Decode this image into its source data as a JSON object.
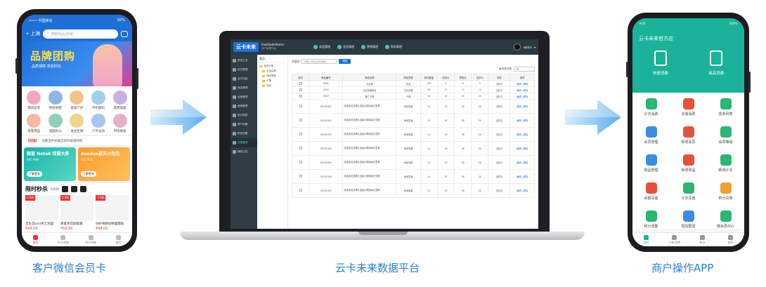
{
  "captions": {
    "customer": "客户微信会员卡",
    "platform": "云卡未来数据平台",
    "merchant": "商户操作APP"
  },
  "customer_phone": {
    "status_left": "•••• 中国移动",
    "status_right": "50%",
    "location": "上海",
    "search_placeholder": "搜索商品/店铺",
    "banner_title": "品牌团购",
    "banner_sub": "品质保障  享受折扣",
    "categories": [
      "潮流女装",
      "男装男鞋",
      "美妆个护",
      "手机数码",
      "家用电器",
      "母婴用品",
      "电脑办公",
      "食品生鲜",
      "户外运动",
      "时尚家居"
    ],
    "notice_tag": "【热销】",
    "notice_text": "大鹏当手机端全新升级限时抢",
    "promos": [
      {
        "title": "魅蓝 Note6 双摄大屏",
        "sub": "SSC Mall",
        "btn": "了解更多"
      },
      {
        "title": "doodoo夏天小包包",
        "sub": "SSC Mall",
        "btn": "了解更多"
      }
    ],
    "flash_title": "限时秒杀",
    "flash_sub": "8点场",
    "goods": [
      {
        "badge": "1 6折",
        "name": "吉生堂uno男士洗面",
        "price": "¥49.00"
      },
      {
        "badge": "1 6折",
        "name": "果麦茶花颜紫霜",
        "price": "¥50.00"
      },
      {
        "badge": "1 6折",
        "name": "SNP海豚动物面膜贴",
        "price": "¥98.00"
      }
    ],
    "tabs": [
      "首页",
      "积分商城",
      "积分明细",
      "我的"
    ]
  },
  "platform": {
    "logo": "云卡未来",
    "brand_name": "FastSaleHome",
    "brand_sub": "商户管理平台",
    "nav": [
      "商品管理",
      "会员管理",
      "营销管理",
      "财务管理"
    ],
    "user": "admin",
    "sidebar": [
      "系统主页",
      "会员管理",
      "会员功能",
      "商品管理",
      "运营管理",
      "营销管理",
      "统计报表",
      "商户设置",
      "系统设置",
      "权限管理",
      "通知公告"
    ],
    "sidebar_active_index": 9,
    "tree_header": "商品",
    "tree_nodes": [
      "全部分类",
      "五谷杂粮",
      "休闲零食",
      "干果",
      "饮品"
    ],
    "filter_label": "关键词",
    "filter_placeholder": "请输入商品名称/编码",
    "filter_button": "搜索",
    "pager_label": "每页显示数",
    "pager_value": "10",
    "columns": [
      "选中",
      "商品编号",
      "商品名称",
      "商品类别",
      "库存数量",
      "成本价",
      "零售价",
      "会员价",
      "状态",
      "操作"
    ],
    "rows": [
      [
        "",
        "0001",
        "乌龙茶",
        "饮品",
        "100",
        "3",
        "6",
        "5",
        "出售中",
        "编辑 | 删除"
      ],
      [
        "",
        "0002",
        "五谷杂粮组合",
        "五谷杂粮",
        "50",
        "8",
        "15",
        "12",
        "出售中",
        "编辑 | 删除"
      ],
      [
        "",
        "0003",
        "果仁干果",
        "干果",
        "20",
        "12",
        "25",
        "20",
        "出售中",
        "编辑 | 删除"
      ],
      [
        "",
        "SP201901",
        "精选混合坚果礼盒装大颗粒每日坚果",
        "休闲零食",
        "10",
        "30",
        "58",
        "50",
        "出售中",
        "编辑 | 删除"
      ],
      [
        "",
        "SP201902",
        "精选混合坚果礼盒装大颗粒每日坚果",
        "休闲零食",
        "10",
        "30",
        "58",
        "50",
        "出售中",
        "编辑 | 删除"
      ],
      [
        "",
        "SP201903",
        "精选混合坚果礼盒装大颗粒每日坚果",
        "休闲零食",
        "10",
        "30",
        "58",
        "50",
        "出售中",
        "编辑 | 删除"
      ],
      [
        "",
        "SP201904",
        "精选混合坚果礼盒装大颗粒每日坚果",
        "休闲零食",
        "10",
        "30",
        "58",
        "50",
        "出售中",
        "编辑 | 删除"
      ],
      [
        "",
        "SP201905",
        "精选混合坚果礼盒装大颗粒每日坚果",
        "休闲零食",
        "10",
        "30",
        "58",
        "50",
        "出售中",
        "编辑 | 删除"
      ],
      [
        "",
        "SP201906",
        "精选混合坚果礼盒装大颗粒每日坚果",
        "休闲零食",
        "10",
        "30",
        "58",
        "50",
        "出售中",
        "编辑 | 删除"
      ],
      [
        "",
        "SP201907",
        "精选混合坚果礼盒装大颗粒每日坚果",
        "休闲零食",
        "10",
        "30",
        "58",
        "50",
        "出售中",
        "编辑 | 删除"
      ]
    ]
  },
  "merchant_phone": {
    "status_left": "9:41",
    "status_right": "100%",
    "shop_name": "云卡未来官方店",
    "quick": [
      "快速消费",
      "商品消费"
    ],
    "menu": [
      {
        "label": "计次消费",
        "color": "#2bb673"
      },
      {
        "label": "充值消费",
        "color": "#e8503a"
      },
      {
        "label": "挂单列表",
        "color": "#2bb673"
      },
      {
        "label": "会员管理",
        "color": "#3a8ee6"
      },
      {
        "label": "新增会员",
        "color": "#e8503a"
      },
      {
        "label": "会员等级",
        "color": "#2bb673"
      },
      {
        "label": "商品管理",
        "color": "#3a8ee6"
      },
      {
        "label": "新增商品",
        "color": "#e8503a"
      },
      {
        "label": "新增计次",
        "color": "#2bb673"
      },
      {
        "label": "余额充值",
        "color": "#e8503a"
      },
      {
        "label": "计次充值",
        "color": "#2bb673"
      },
      {
        "label": "积分兑换",
        "color": "#f0a030"
      },
      {
        "label": "积分调整",
        "color": "#2bb673"
      },
      {
        "label": "短信群发",
        "color": "#3a8ee6"
      },
      {
        "label": "微会员中心",
        "color": "#2bb673"
      }
    ],
    "tabs": [
      "首页",
      "订单/消费",
      "统计",
      "我的"
    ]
  }
}
